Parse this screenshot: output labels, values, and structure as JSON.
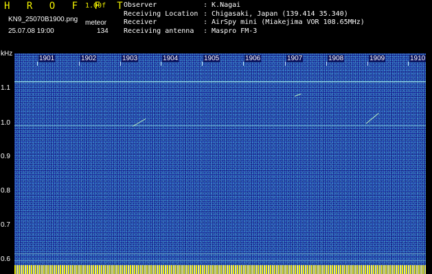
{
  "header": {
    "logo": "H R O F F T",
    "version": "1.00f",
    "filename": "KN9_25070B1900.png",
    "datetime": "25.07.08 19:00",
    "meteor_label": "meteor",
    "meteor_count": "134"
  },
  "info": [
    {
      "key": "Observer",
      "value": ": K.Nagai"
    },
    {
      "key": "Receiving Location",
      "value": ": Chigasaki, Japan (139.414 35.340)"
    },
    {
      "key": "Receiver",
      "value": ": AirSpy mini (Miakejima VOR 108.65MHz)"
    },
    {
      "key": "Receiving antenna",
      "value": ": Maspro FM-3"
    }
  ],
  "axis": {
    "unit": "kHz",
    "y_ticks": [
      "1.1",
      "1.0",
      "0.9",
      "0.8",
      "0.7",
      "0.6"
    ],
    "x_ticks": [
      "1901",
      "1902",
      "1903",
      "1904",
      "1905",
      "1906",
      "1907",
      "1908",
      "1909",
      "1910"
    ]
  },
  "colors": {
    "background": "#000000",
    "logo": "#f2f200",
    "spectrum_base": "#1e2f9f",
    "carrier_line": "#9ff0e0"
  }
}
